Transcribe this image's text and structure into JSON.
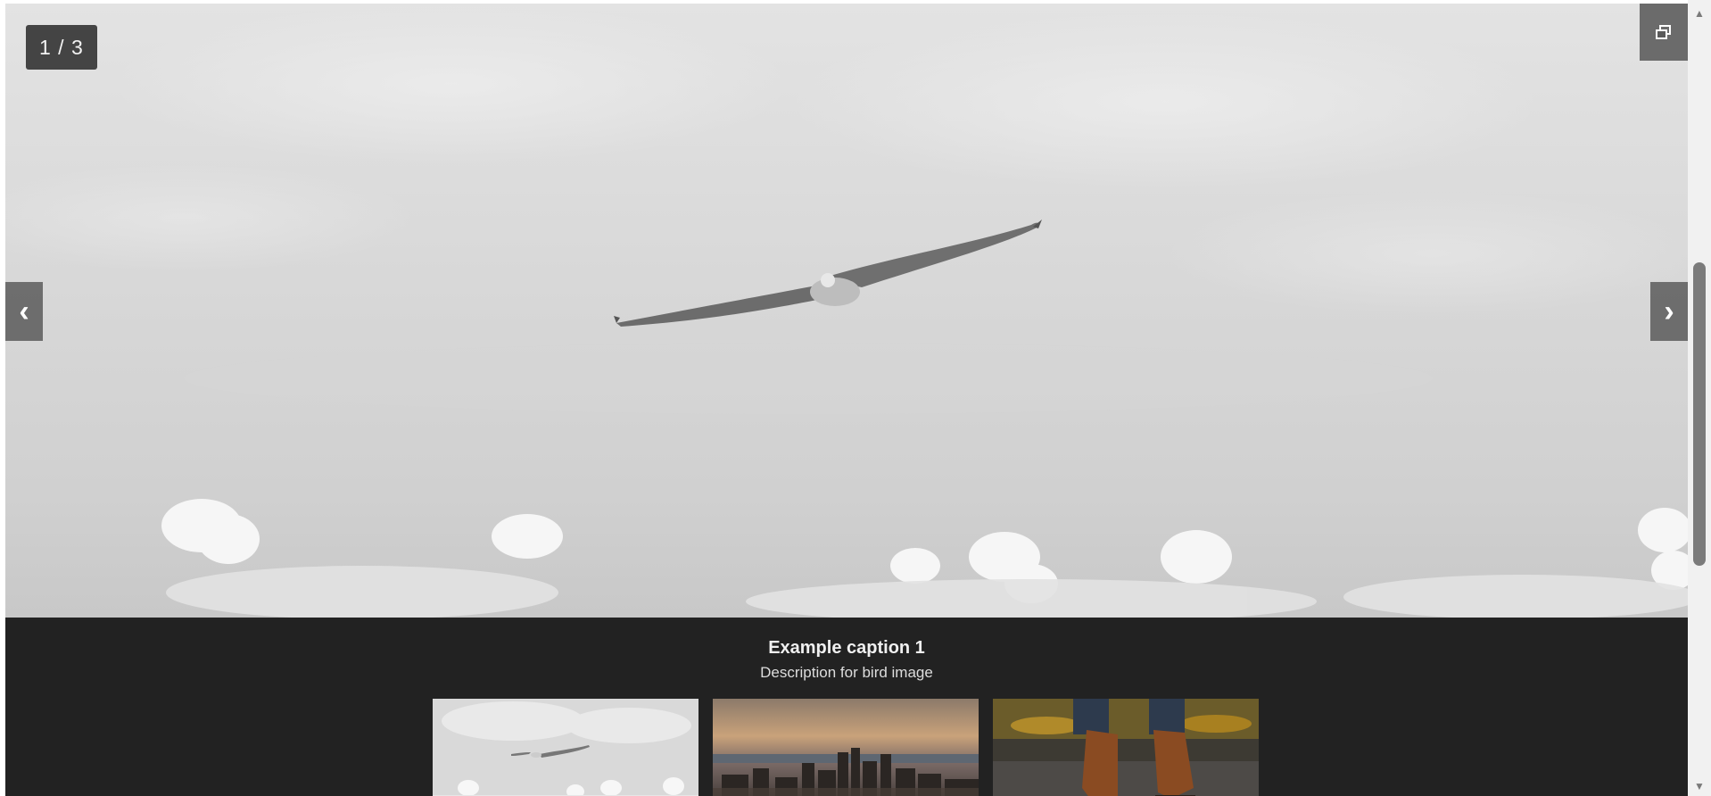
{
  "slideshow": {
    "counter": "1 / 3",
    "caption_title": "Example caption 1",
    "caption_description": "Description for bird image",
    "prev_label": "‹",
    "next_label": "›"
  },
  "thumbnails": [
    {
      "subject": "bird"
    },
    {
      "subject": "city-skyline"
    },
    {
      "subject": "boots"
    }
  ],
  "scrollbar": {
    "up_arrow": "▲",
    "down_arrow": "▼"
  },
  "icons": {
    "fullscreen": "restore-window-icon"
  }
}
